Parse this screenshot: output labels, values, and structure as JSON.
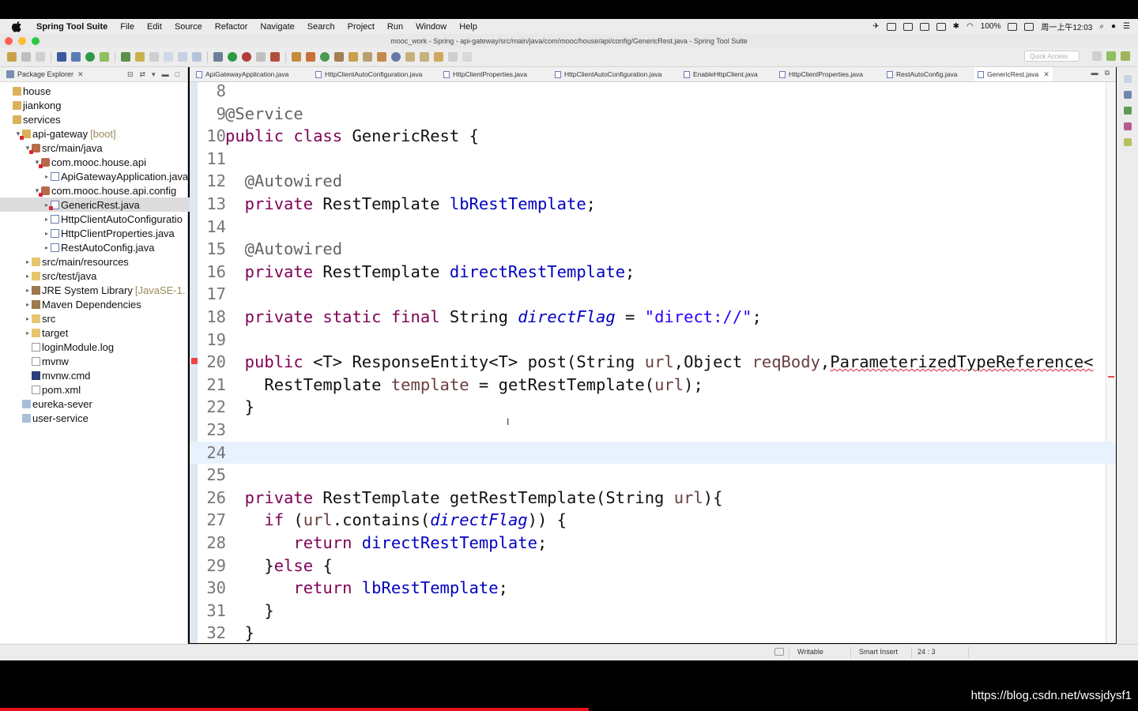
{
  "menubar": {
    "app_name": "Spring Tool Suite",
    "items": [
      "File",
      "Edit",
      "Source",
      "Refactor",
      "Navigate",
      "Search",
      "Project",
      "Run",
      "Window",
      "Help"
    ],
    "battery": "100%",
    "clock": "周一上午12:03"
  },
  "window": {
    "title": "mooc_work - Spring - api-gateway/src/main/java/com/mooc/house/api/config/GenericRest.java - Spring Tool Suite"
  },
  "toolbar": {
    "quick_access_placeholder": "Quick Access"
  },
  "explorer": {
    "title": "Package Explorer",
    "tree": [
      {
        "label": "house",
        "level": 0,
        "twisty": "",
        "icon": "project-icon",
        "selected": false
      },
      {
        "label": "jiankong",
        "level": 0,
        "twisty": "",
        "icon": "project-icon",
        "selected": false
      },
      {
        "label": "services",
        "level": 0,
        "twisty": "",
        "icon": "project-icon",
        "selected": false
      },
      {
        "label": "api-gateway",
        "decor": "[boot]",
        "level": 1,
        "twisty": "▼",
        "icon": "project-icon",
        "error": true,
        "selected": false
      },
      {
        "label": "src/main/java",
        "level": 2,
        "twisty": "▼",
        "icon": "package-icon",
        "error": true,
        "selected": false
      },
      {
        "label": "com.mooc.house.api",
        "level": 3,
        "twisty": "▼",
        "icon": "package-icon",
        "error": true,
        "selected": false
      },
      {
        "label": "ApiGatewayApplication.java",
        "level": 4,
        "twisty": "▸",
        "icon": "java-file-icon",
        "selected": false
      },
      {
        "label": "com.mooc.house.api.config",
        "level": 3,
        "twisty": "▼",
        "icon": "package-icon",
        "error": true,
        "selected": false
      },
      {
        "label": "GenericRest.java",
        "level": 4,
        "twisty": "▸",
        "icon": "java-file-icon",
        "error": true,
        "selected": true
      },
      {
        "label": "HttpClientAutoConfiguratio",
        "level": 4,
        "twisty": "▸",
        "icon": "java-file-icon",
        "selected": false
      },
      {
        "label": "HttpClientProperties.java",
        "level": 4,
        "twisty": "▸",
        "icon": "java-file-icon",
        "selected": false
      },
      {
        "label": "RestAutoConfig.java",
        "level": 4,
        "twisty": "▸",
        "icon": "java-file-icon",
        "selected": false
      },
      {
        "label": "src/main/resources",
        "level": 2,
        "twisty": "▸",
        "icon": "folder-icon",
        "selected": false
      },
      {
        "label": "src/test/java",
        "level": 2,
        "twisty": "▸",
        "icon": "folder-icon",
        "selected": false
      },
      {
        "label": "JRE System Library",
        "decor": "[JavaSE-1.",
        "level": 2,
        "twisty": "▸",
        "icon": "library-icon",
        "selected": false
      },
      {
        "label": "Maven Dependencies",
        "level": 2,
        "twisty": "▸",
        "icon": "library-icon",
        "selected": false
      },
      {
        "label": "src",
        "level": 2,
        "twisty": "▸",
        "icon": "folder-icon",
        "selected": false
      },
      {
        "label": "target",
        "level": 2,
        "twisty": "▸",
        "icon": "folder-icon",
        "selected": false
      },
      {
        "label": "loginModule.log",
        "level": 2,
        "twisty": "",
        "icon": "file-icon",
        "selected": false
      },
      {
        "label": "mvnw",
        "level": 2,
        "twisty": "",
        "icon": "file-icon",
        "selected": false
      },
      {
        "label": "mvnw.cmd",
        "level": 2,
        "twisty": "",
        "icon": "cmd-file-icon",
        "selected": false
      },
      {
        "label": "pom.xml",
        "level": 2,
        "twisty": "",
        "icon": "file-icon",
        "selected": false
      },
      {
        "label": "eureka-sever",
        "level": 1,
        "twisty": "",
        "icon": "project-icon-2",
        "selected": false
      },
      {
        "label": "user-service",
        "level": 1,
        "twisty": "",
        "icon": "project-icon-2",
        "selected": false
      }
    ]
  },
  "editor": {
    "tabs": [
      {
        "label": "ApiGatewayApplication.java",
        "active": false
      },
      {
        "label": "HttpClientAutoConfiguration.java",
        "active": false
      },
      {
        "label": "HttpClientProperties.java",
        "active": false
      },
      {
        "label": "HttpClientAutoConfiguration.java",
        "active": false
      },
      {
        "label": "EnableHttpClient.java",
        "active": false
      },
      {
        "label": "HttpClientProperties.java",
        "active": false
      },
      {
        "label": "RestAutoConfig.java",
        "active": false
      },
      {
        "label": "GenericRest.java",
        "active": true
      }
    ],
    "lines": [
      {
        "num": "8",
        "tokens": []
      },
      {
        "num": "9",
        "tokens": [
          {
            "t": "@Service",
            "c": "ann"
          }
        ]
      },
      {
        "num": "10",
        "tokens": [
          {
            "t": "public ",
            "c": "kw"
          },
          {
            "t": "class ",
            "c": "kw"
          },
          {
            "t": "GenericRest {",
            "c": ""
          }
        ]
      },
      {
        "num": "11",
        "tokens": []
      },
      {
        "num": "12",
        "fold": true,
        "tokens": [
          {
            "t": "  @Autowired",
            "c": "ann"
          }
        ]
      },
      {
        "num": "13",
        "tokens": [
          {
            "t": "  private ",
            "c": "kw"
          },
          {
            "t": "RestTemplate ",
            "c": ""
          },
          {
            "t": "lbRestTemplate",
            "c": "field"
          },
          {
            "t": ";",
            "c": ""
          }
        ]
      },
      {
        "num": "14",
        "tokens": []
      },
      {
        "num": "15",
        "fold": true,
        "tokens": [
          {
            "t": "  @Autowired",
            "c": "ann"
          }
        ]
      },
      {
        "num": "16",
        "tokens": [
          {
            "t": "  private ",
            "c": "kw"
          },
          {
            "t": "RestTemplate ",
            "c": ""
          },
          {
            "t": "directRestTemplate",
            "c": "field"
          },
          {
            "t": ";",
            "c": ""
          }
        ]
      },
      {
        "num": "17",
        "tokens": []
      },
      {
        "num": "18",
        "tokens": [
          {
            "t": "  private ",
            "c": "kw"
          },
          {
            "t": "static ",
            "c": "kw"
          },
          {
            "t": "final ",
            "c": "kw"
          },
          {
            "t": "String ",
            "c": ""
          },
          {
            "t": "directFlag",
            "c": "sfield"
          },
          {
            "t": " = ",
            "c": ""
          },
          {
            "t": "\"direct://\"",
            "c": "str"
          },
          {
            "t": ";",
            "c": ""
          }
        ]
      },
      {
        "num": "19",
        "tokens": []
      },
      {
        "num": "20",
        "fold": true,
        "error": true,
        "tokens": [
          {
            "t": "  public ",
            "c": "kw"
          },
          {
            "t": "<T> ResponseEntity<T> post(String ",
            "c": ""
          },
          {
            "t": "url",
            "c": "var"
          },
          {
            "t": ",Object ",
            "c": ""
          },
          {
            "t": "reqBody",
            "c": "var"
          },
          {
            "t": ",",
            "c": ""
          },
          {
            "t": "ParameterizedTypeReference<",
            "c": "squig"
          }
        ]
      },
      {
        "num": "21",
        "tokens": [
          {
            "t": "    RestTemplate ",
            "c": ""
          },
          {
            "t": "template",
            "c": "var"
          },
          {
            "t": " = getRestTemplate(",
            "c": ""
          },
          {
            "t": "url",
            "c": "var"
          },
          {
            "t": ");",
            "c": ""
          }
        ]
      },
      {
        "num": "22",
        "tokens": [
          {
            "t": "  }",
            "c": ""
          }
        ]
      },
      {
        "num": "23",
        "tokens": []
      },
      {
        "num": "24",
        "current": true,
        "tokens": []
      },
      {
        "num": "25",
        "tokens": []
      },
      {
        "num": "26",
        "fold": true,
        "tokens": [
          {
            "t": "  private ",
            "c": "kw"
          },
          {
            "t": "RestTemplate getRestTemplate(String ",
            "c": ""
          },
          {
            "t": "url",
            "c": "var"
          },
          {
            "t": "){",
            "c": ""
          }
        ]
      },
      {
        "num": "27",
        "tokens": [
          {
            "t": "    if ",
            "c": "kw"
          },
          {
            "t": "(",
            "c": ""
          },
          {
            "t": "url",
            "c": "var"
          },
          {
            "t": ".contains(",
            "c": ""
          },
          {
            "t": "directFlag",
            "c": "sfield"
          },
          {
            "t": ")) {",
            "c": ""
          }
        ]
      },
      {
        "num": "28",
        "tokens": [
          {
            "t": "       return ",
            "c": "kw"
          },
          {
            "t": "directRestTemplate",
            "c": "field"
          },
          {
            "t": ";",
            "c": ""
          }
        ]
      },
      {
        "num": "29",
        "tokens": [
          {
            "t": "    }",
            "c": ""
          },
          {
            "t": "else ",
            "c": "kw"
          },
          {
            "t": "{",
            "c": ""
          }
        ]
      },
      {
        "num": "30",
        "tokens": [
          {
            "t": "       return ",
            "c": "kw"
          },
          {
            "t": "lbRestTemplate",
            "c": "field"
          },
          {
            "t": ";",
            "c": ""
          }
        ]
      },
      {
        "num": "31",
        "tokens": [
          {
            "t": "    }",
            "c": ""
          }
        ]
      },
      {
        "num": "32",
        "tokens": [
          {
            "t": "  }",
            "c": ""
          }
        ]
      }
    ]
  },
  "statusbar": {
    "writable": "Writable",
    "insert_mode": "Smart Insert",
    "position": "24 : 3"
  },
  "watermark": "https://blog.csdn.net/wssjdysf1",
  "colors": {
    "keyword": "#7f0055",
    "field": "#0000c0",
    "string": "#2a00ff",
    "annotation": "#646464",
    "local_var": "#6a3e3e",
    "current_line": "#e8f2fe",
    "selection": "#dcdcdc",
    "progress": "#e5141a"
  }
}
